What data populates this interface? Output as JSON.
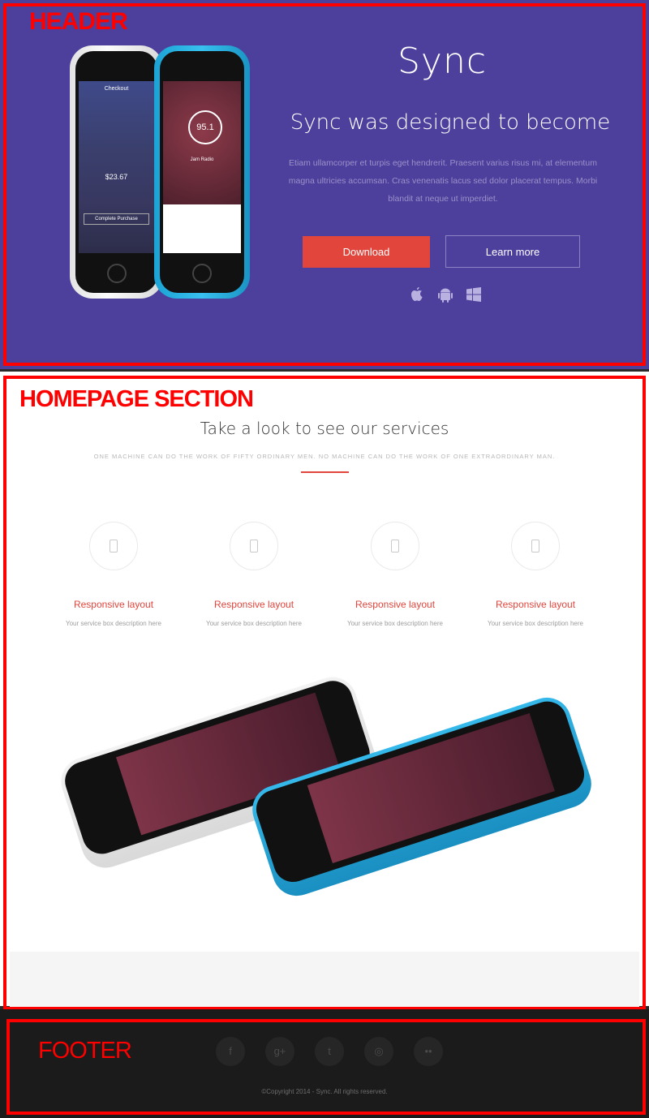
{
  "annotations": {
    "header": "HEADER",
    "homepage": "HOMEPAGE SECTION",
    "footer": "FOOTER"
  },
  "hero": {
    "brand": "Sync",
    "headline": "Sync was designed to become",
    "lead": "Etiam ullamcorper et turpis eget hendrerit. Praesent varius risus mi, at elementum magna ultricies accumsan. Cras venenatis lacus sed dolor placerat tempus. Morbi blandit at neque ut imperdiet.",
    "download_label": "Download",
    "learn_label": "Learn more",
    "platforms": [
      "apple-icon",
      "android-icon",
      "windows-icon"
    ]
  },
  "phone_screens": {
    "shop_price": "$23.67",
    "shop_title": "Checkout",
    "shop_action": "Complete Purchase",
    "radio_value": "95.1",
    "radio_station": "Jam Radio"
  },
  "services": {
    "title": "Take a look to see our services",
    "subtitle": "ONE MACHINE CAN DO THE WORK OF FIFTY ORDINARY MEN. NO MACHINE CAN DO THE WORK OF ONE EXTRAORDINARY MAN.",
    "items": [
      {
        "title": "Responsive layout",
        "desc": "Your service box description here"
      },
      {
        "title": "Responsive layout",
        "desc": "Your service box description here"
      },
      {
        "title": "Responsive layout",
        "desc": "Your service box description here"
      },
      {
        "title": "Responsive layout",
        "desc": "Your service box description here"
      }
    ]
  },
  "footer": {
    "social": [
      {
        "icon": "facebook-icon",
        "glyph": "f"
      },
      {
        "icon": "google-plus-icon",
        "glyph": "g+"
      },
      {
        "icon": "twitter-icon",
        "glyph": "t"
      },
      {
        "icon": "dribbble-icon",
        "glyph": "◎"
      },
      {
        "icon": "flickr-icon",
        "glyph": "••"
      }
    ],
    "copyright": "©Copyright 2014 - Sync. All rights reserved."
  },
  "colors": {
    "header_bg": "#4d3f9c",
    "accent": "#e2453c",
    "footer_bg": "#1b1b1b",
    "annotation": "#ff0000"
  }
}
